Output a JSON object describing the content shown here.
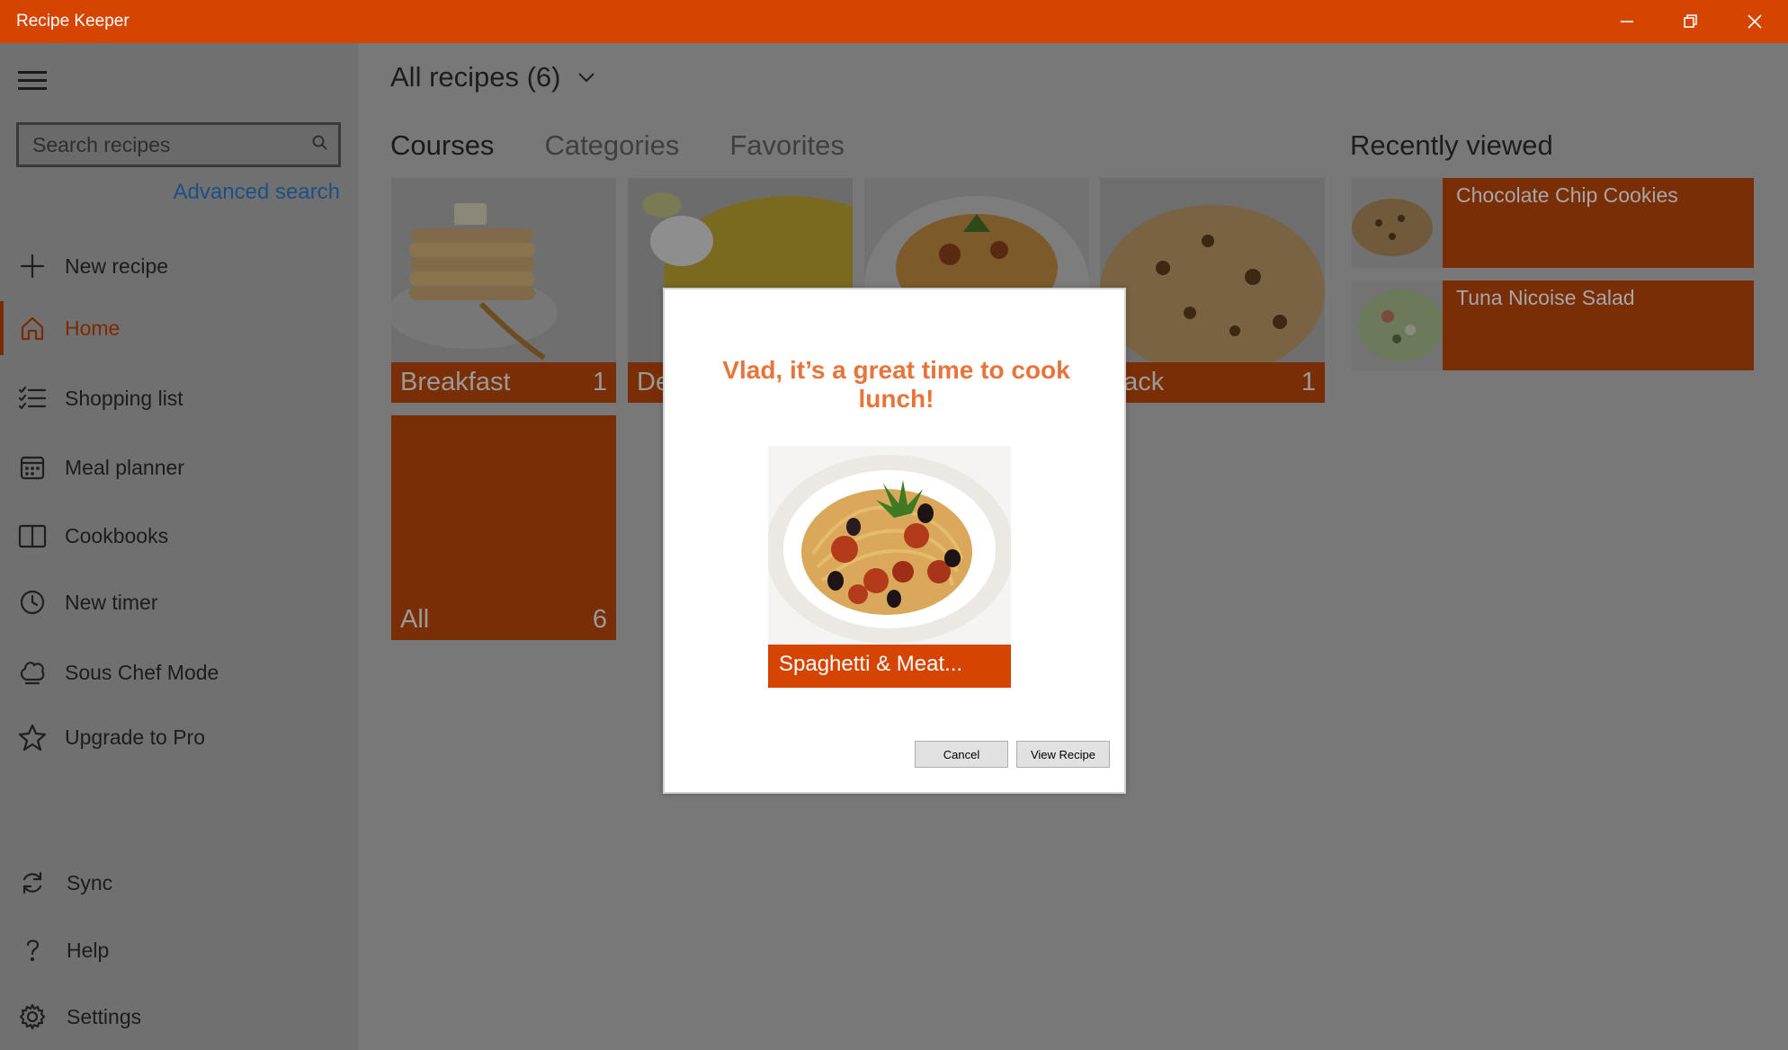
{
  "window": {
    "title": "Recipe Keeper",
    "accent": "#d54400"
  },
  "sidebar": {
    "search_placeholder": "Search recipes",
    "advanced_search": "Advanced search",
    "items": [
      {
        "label": "New recipe",
        "icon": "plus-icon"
      },
      {
        "label": "Home",
        "icon": "home-icon"
      },
      {
        "label": "Shopping list",
        "icon": "checklist-icon"
      },
      {
        "label": "Meal planner",
        "icon": "calendar-icon"
      },
      {
        "label": "Cookbooks",
        "icon": "book-icon"
      },
      {
        "label": "New timer",
        "icon": "clock-icon"
      },
      {
        "label": "Sous Chef Mode",
        "icon": "chef-hat-icon"
      },
      {
        "label": "Upgrade to Pro",
        "icon": "star-icon"
      }
    ],
    "bottom_items": [
      {
        "label": "Sync",
        "icon": "sync-icon"
      },
      {
        "label": "Help",
        "icon": "help-icon"
      },
      {
        "label": "Settings",
        "icon": "gear-icon"
      }
    ]
  },
  "main": {
    "header": "All recipes (6)",
    "tabs": [
      "Courses",
      "Categories",
      "Favorites"
    ],
    "tiles": [
      {
        "label": "Breakfast",
        "count": "1"
      },
      {
        "label": "De",
        "count": ""
      },
      {
        "label": "",
        "count": ""
      },
      {
        "label": "nack",
        "count": "1"
      },
      {
        "label": "All",
        "count": "6"
      }
    ],
    "recently_viewed_title": "Recently viewed",
    "recently_viewed": [
      {
        "name": "Chocolate Chip Cookies"
      },
      {
        "name": "Tuna Nicoise Salad"
      }
    ]
  },
  "dialog": {
    "heading": "Vlad, it’s a great time to cook lunch!",
    "recipe_name": "Spaghetti & Meat...",
    "cancel": "Cancel",
    "view": "View Recipe"
  }
}
